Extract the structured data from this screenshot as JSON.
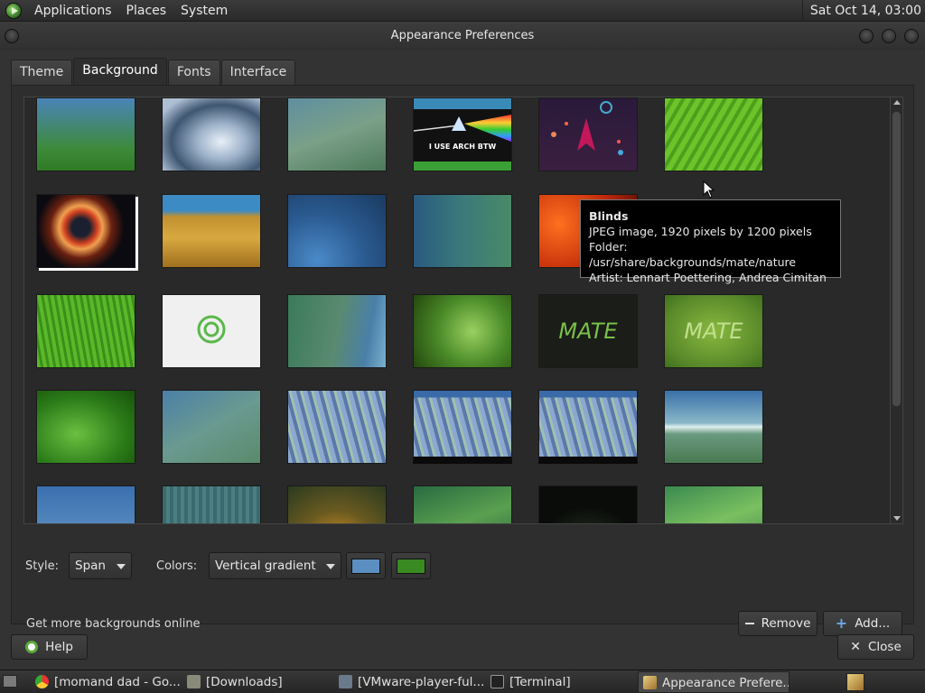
{
  "top_panel": {
    "menus": [
      "Applications",
      "Places",
      "System"
    ],
    "clock": "Sat Oct 14, 03:00"
  },
  "window": {
    "title": "Appearance Preferences",
    "tabs": [
      "Theme",
      "Background",
      "Fonts",
      "Interface"
    ],
    "active_tab": "Background"
  },
  "backgrounds": {
    "tooltip": {
      "title": "Blinds",
      "line1": "JPEG image, 1920 pixels by 1200 pixels",
      "line2": "Folder: /usr/share/backgrounds/mate/nature",
      "line3": "Artist: Lennart Poettering, Andrea Cimitan"
    },
    "thumbnail_text": {
      "arch": "I USE ARCH BTW",
      "mate": "MATE"
    }
  },
  "controls": {
    "style_label": "Style:",
    "style_value": "Span",
    "colors_label": "Colors:",
    "colors_value": "Vertical gradient",
    "primary_color": "#5b8fc2",
    "secondary_color": "#3a8a22",
    "get_more": "Get more backgrounds online",
    "remove_label": "Remove",
    "add_label": "Add...",
    "help_label": "Help",
    "close_label": "Close"
  },
  "taskbar": {
    "items": [
      "[momand dad - Go...",
      "[Downloads]",
      "[VMware-player-ful...",
      "[Terminal]",
      "Appearance Prefere..."
    ]
  },
  "colors": {
    "accent": "#b0b0b0",
    "panel_bg": "#2e2e2e"
  }
}
